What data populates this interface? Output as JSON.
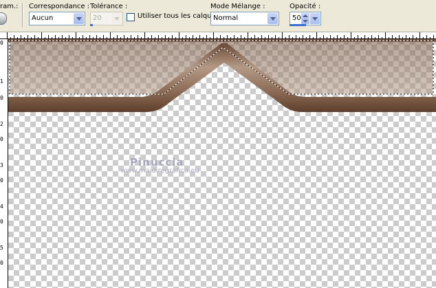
{
  "toolbar": {
    "partial_label": "ram.:",
    "correspondance_label": "Correspondance :",
    "correspondance_value": "Aucun",
    "tolerance_label": "Tolérance :",
    "tolerance_value": "20",
    "all_layers_label": "Utiliser tous les calques",
    "blend_mode_label": "Mode Mélange :",
    "blend_mode_value": "Normal",
    "opacity_label": "Opacité :",
    "opacity_value": "50"
  },
  "ruler_left_ticks": [
    "0",
    "1",
    "0",
    "2",
    "0",
    "3",
    "0",
    "4",
    "0",
    "5",
    "0"
  ],
  "watermark": {
    "name": "Pinuccia",
    "url": "www.maidiregrafica.eu"
  },
  "colors": {
    "band_light": "#b49a86",
    "band_dark": "#7a5a45",
    "selection": "#000000",
    "toolbar_bg": "#ece9d8"
  }
}
